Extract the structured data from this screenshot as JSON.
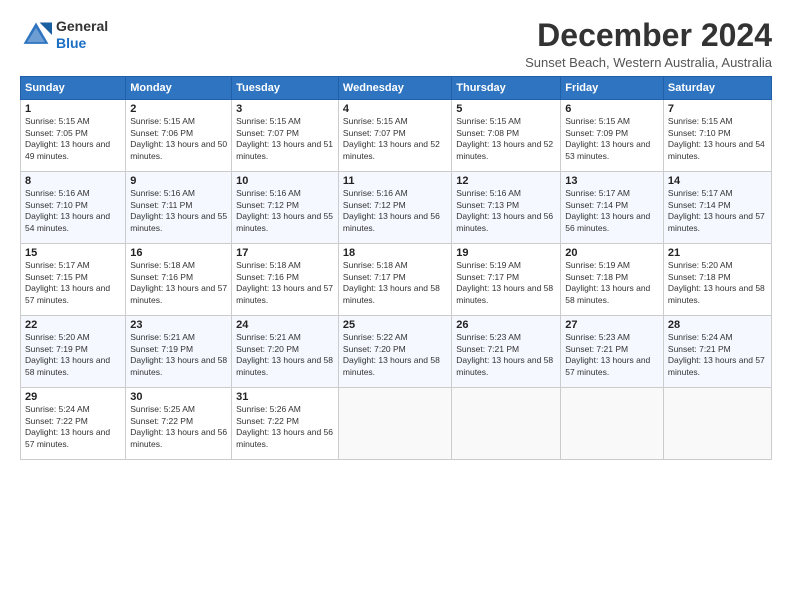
{
  "logo": {
    "line1": "General",
    "line2": "Blue"
  },
  "title": "December 2024",
  "subtitle": "Sunset Beach, Western Australia, Australia",
  "headers": [
    "Sunday",
    "Monday",
    "Tuesday",
    "Wednesday",
    "Thursday",
    "Friday",
    "Saturday"
  ],
  "weeks": [
    [
      {
        "day": "1",
        "sunrise": "5:15 AM",
        "sunset": "7:05 PM",
        "daylight": "13 hours and 49 minutes."
      },
      {
        "day": "2",
        "sunrise": "5:15 AM",
        "sunset": "7:06 PM",
        "daylight": "13 hours and 50 minutes."
      },
      {
        "day": "3",
        "sunrise": "5:15 AM",
        "sunset": "7:07 PM",
        "daylight": "13 hours and 51 minutes."
      },
      {
        "day": "4",
        "sunrise": "5:15 AM",
        "sunset": "7:07 PM",
        "daylight": "13 hours and 52 minutes."
      },
      {
        "day": "5",
        "sunrise": "5:15 AM",
        "sunset": "7:08 PM",
        "daylight": "13 hours and 52 minutes."
      },
      {
        "day": "6",
        "sunrise": "5:15 AM",
        "sunset": "7:09 PM",
        "daylight": "13 hours and 53 minutes."
      },
      {
        "day": "7",
        "sunrise": "5:15 AM",
        "sunset": "7:10 PM",
        "daylight": "13 hours and 54 minutes."
      }
    ],
    [
      {
        "day": "8",
        "sunrise": "5:16 AM",
        "sunset": "7:10 PM",
        "daylight": "13 hours and 54 minutes."
      },
      {
        "day": "9",
        "sunrise": "5:16 AM",
        "sunset": "7:11 PM",
        "daylight": "13 hours and 55 minutes."
      },
      {
        "day": "10",
        "sunrise": "5:16 AM",
        "sunset": "7:12 PM",
        "daylight": "13 hours and 55 minutes."
      },
      {
        "day": "11",
        "sunrise": "5:16 AM",
        "sunset": "7:12 PM",
        "daylight": "13 hours and 56 minutes."
      },
      {
        "day": "12",
        "sunrise": "5:16 AM",
        "sunset": "7:13 PM",
        "daylight": "13 hours and 56 minutes."
      },
      {
        "day": "13",
        "sunrise": "5:17 AM",
        "sunset": "7:14 PM",
        "daylight": "13 hours and 56 minutes."
      },
      {
        "day": "14",
        "sunrise": "5:17 AM",
        "sunset": "7:14 PM",
        "daylight": "13 hours and 57 minutes."
      }
    ],
    [
      {
        "day": "15",
        "sunrise": "5:17 AM",
        "sunset": "7:15 PM",
        "daylight": "13 hours and 57 minutes."
      },
      {
        "day": "16",
        "sunrise": "5:18 AM",
        "sunset": "7:16 PM",
        "daylight": "13 hours and 57 minutes."
      },
      {
        "day": "17",
        "sunrise": "5:18 AM",
        "sunset": "7:16 PM",
        "daylight": "13 hours and 57 minutes."
      },
      {
        "day": "18",
        "sunrise": "5:18 AM",
        "sunset": "7:17 PM",
        "daylight": "13 hours and 58 minutes."
      },
      {
        "day": "19",
        "sunrise": "5:19 AM",
        "sunset": "7:17 PM",
        "daylight": "13 hours and 58 minutes."
      },
      {
        "day": "20",
        "sunrise": "5:19 AM",
        "sunset": "7:18 PM",
        "daylight": "13 hours and 58 minutes."
      },
      {
        "day": "21",
        "sunrise": "5:20 AM",
        "sunset": "7:18 PM",
        "daylight": "13 hours and 58 minutes."
      }
    ],
    [
      {
        "day": "22",
        "sunrise": "5:20 AM",
        "sunset": "7:19 PM",
        "daylight": "13 hours and 58 minutes."
      },
      {
        "day": "23",
        "sunrise": "5:21 AM",
        "sunset": "7:19 PM",
        "daylight": "13 hours and 58 minutes."
      },
      {
        "day": "24",
        "sunrise": "5:21 AM",
        "sunset": "7:20 PM",
        "daylight": "13 hours and 58 minutes."
      },
      {
        "day": "25",
        "sunrise": "5:22 AM",
        "sunset": "7:20 PM",
        "daylight": "13 hours and 58 minutes."
      },
      {
        "day": "26",
        "sunrise": "5:23 AM",
        "sunset": "7:21 PM",
        "daylight": "13 hours and 58 minutes."
      },
      {
        "day": "27",
        "sunrise": "5:23 AM",
        "sunset": "7:21 PM",
        "daylight": "13 hours and 57 minutes."
      },
      {
        "day": "28",
        "sunrise": "5:24 AM",
        "sunset": "7:21 PM",
        "daylight": "13 hours and 57 minutes."
      }
    ],
    [
      {
        "day": "29",
        "sunrise": "5:24 AM",
        "sunset": "7:22 PM",
        "daylight": "13 hours and 57 minutes."
      },
      {
        "day": "30",
        "sunrise": "5:25 AM",
        "sunset": "7:22 PM",
        "daylight": "13 hours and 56 minutes."
      },
      {
        "day": "31",
        "sunrise": "5:26 AM",
        "sunset": "7:22 PM",
        "daylight": "13 hours and 56 minutes."
      },
      null,
      null,
      null,
      null
    ]
  ]
}
